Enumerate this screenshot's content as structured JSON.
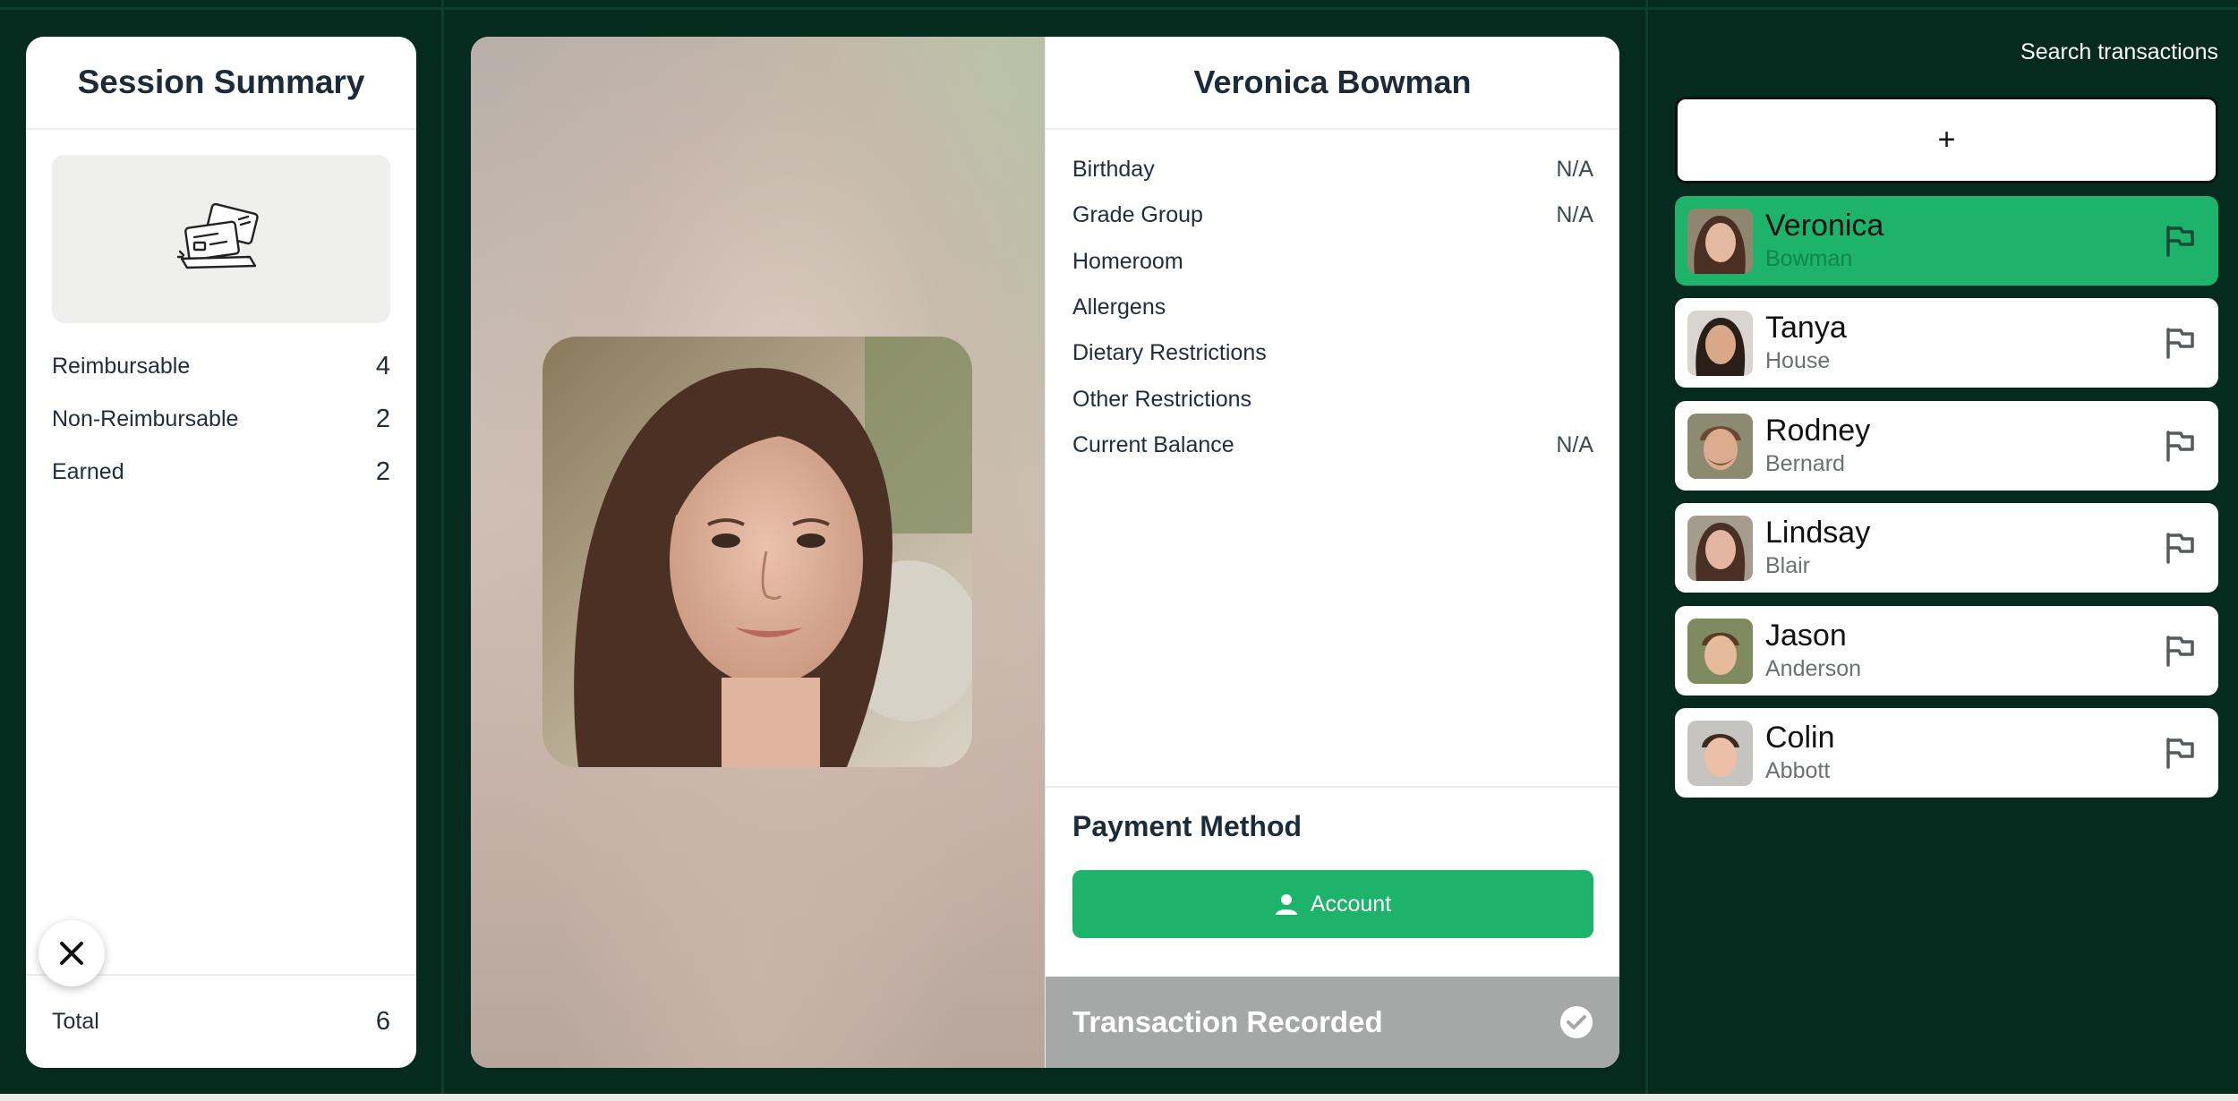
{
  "summary": {
    "title": "Session Summary",
    "stats": [
      {
        "label": "Reimbursable",
        "value": "4"
      },
      {
        "label": "Non-Reimbursable",
        "value": "2"
      },
      {
        "label": "Earned",
        "value": "2"
      }
    ],
    "total_label": "Total",
    "total_value": "6",
    "illustration_icon": "cards-icon",
    "close_icon": "close-icon"
  },
  "profile": {
    "name": "Veronica Bowman",
    "fields": [
      {
        "label": "Birthday",
        "value": "N/A"
      },
      {
        "label": "Grade Group",
        "value": "N/A"
      },
      {
        "label": "Homeroom",
        "value": ""
      },
      {
        "label": "Allergens",
        "value": ""
      },
      {
        "label": "Dietary Restrictions",
        "value": ""
      },
      {
        "label": "Other Restrictions",
        "value": ""
      },
      {
        "label": "Current Balance",
        "value": "N/A"
      }
    ],
    "payment_title": "Payment Method",
    "payment_button": "Account",
    "status": "Transaction Recorded"
  },
  "sidebar": {
    "search_label": "Search transactions",
    "add_label": "+",
    "people": [
      {
        "first": "Veronica",
        "last": "Bowman",
        "active": true
      },
      {
        "first": "Tanya",
        "last": "House",
        "active": false
      },
      {
        "first": "Rodney",
        "last": "Bernard",
        "active": false
      },
      {
        "first": "Lindsay",
        "last": "Blair",
        "active": false
      },
      {
        "first": "Jason",
        "last": "Anderson",
        "active": false
      },
      {
        "first": "Colin",
        "last": "Abbott",
        "active": false
      }
    ]
  },
  "colors": {
    "background": "#042b1e",
    "accent": "#1db36a",
    "status_bar": "#a6a8a8"
  }
}
